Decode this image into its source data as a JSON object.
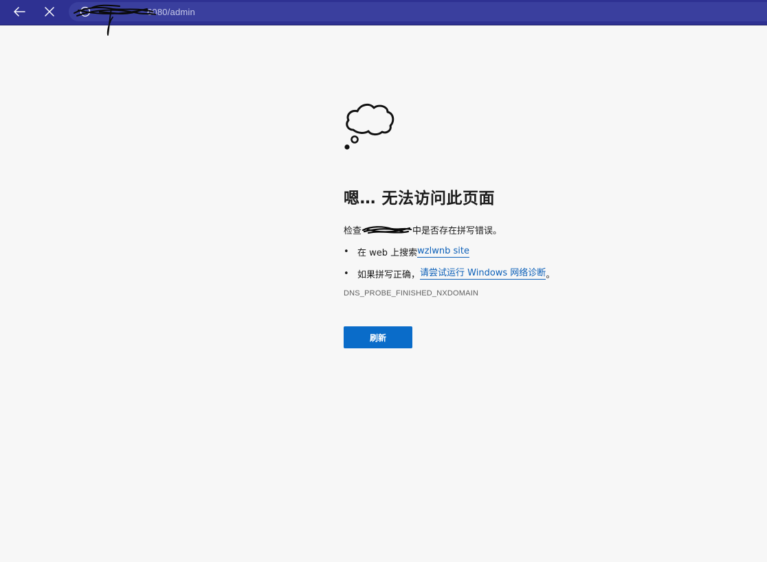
{
  "browser": {
    "url_visible": "6080/admin",
    "accent": "#2e3192",
    "icons": {
      "back": "back-arrow-icon",
      "stop": "close-icon",
      "info": "info-icon"
    }
  },
  "error_page": {
    "title": "嗯… 无法访问此页面",
    "check_prefix": "检查 ",
    "check_suffix": "中是否存在拼写错误。",
    "search_prefix": "在 web 上搜索 ",
    "search_link": "wzlwnb site",
    "spell_prefix": "如果拼写正确，",
    "diagnose_link": "请尝试运行 Windows 网络诊断",
    "diagnose_suffix": "。",
    "bullet": "•",
    "error_code": "DNS_PROBE_FINISHED_NXDOMAIN",
    "refresh_label": "刷新",
    "refresh_color": "#0a6cc9",
    "link_color": "#0b5fb8"
  }
}
